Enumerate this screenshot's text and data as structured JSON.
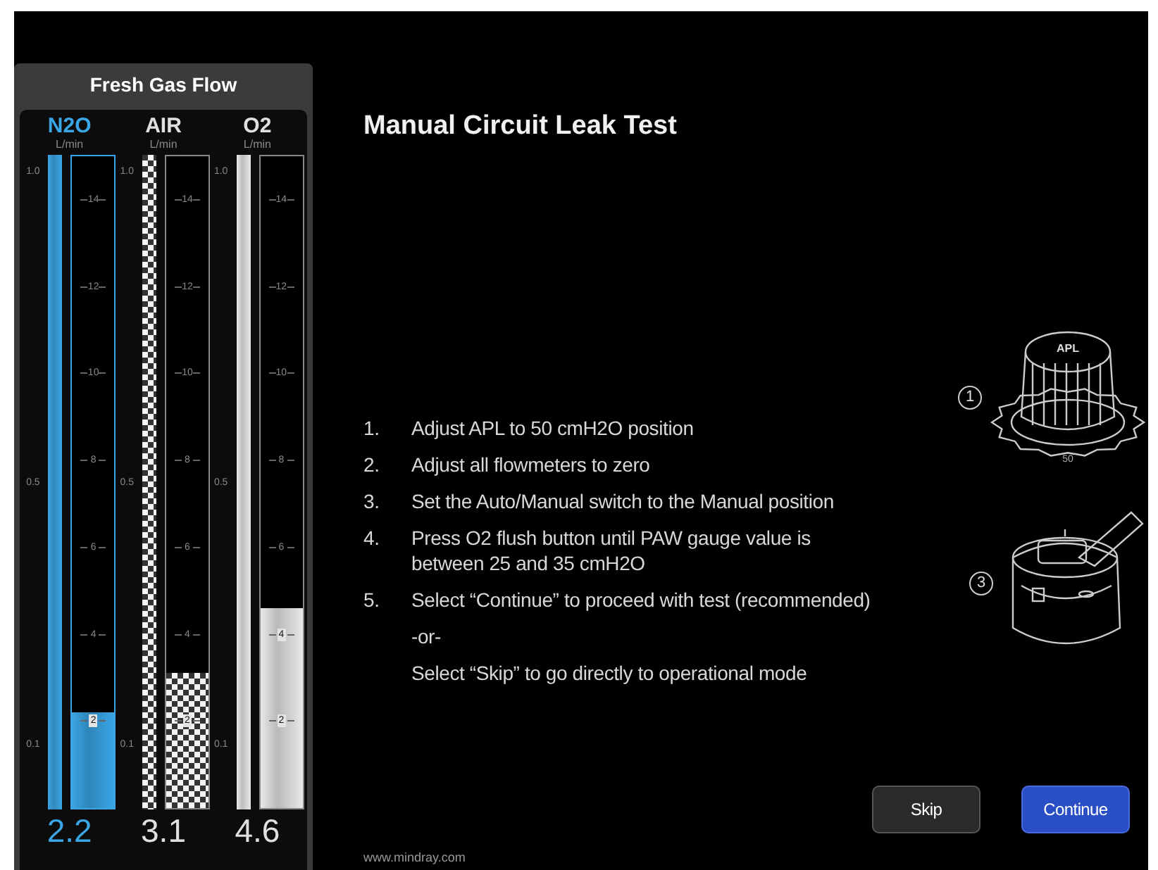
{
  "flow_panel": {
    "title": "Fresh Gas Flow",
    "gases": [
      {
        "name": "N2O",
        "unit": "L/min",
        "kind": "solid",
        "color": "#3aa6e6",
        "value": "2.2",
        "ratio_ticks": [
          "1.0",
          "0.5",
          "0.1"
        ],
        "tube_ticks": [
          "14",
          "12",
          "10",
          "8",
          "6",
          "4",
          "2"
        ],
        "ratio_bar": {
          "level": 1
        },
        "flow_tube": {
          "level": 0.147
        }
      },
      {
        "name": "AIR",
        "unit": "L/min",
        "kind": "checker",
        "color": "#e8e8e8",
        "value": "3.1",
        "ratio_ticks": [
          "1.0",
          "0.5",
          "0.1"
        ],
        "tube_ticks": [
          "14",
          "12",
          "10",
          "8",
          "6",
          "4",
          "2"
        ],
        "ratio_bar": {
          "level": 1
        },
        "flow_tube": {
          "level": 0.207
        }
      },
      {
        "name": "O2",
        "unit": "L/min",
        "kind": "solid",
        "color": "#e8e8e8",
        "value": "4.6",
        "ratio_ticks": [
          "1.0",
          "0.5",
          "0.1"
        ],
        "tube_ticks": [
          "14",
          "12",
          "10",
          "8",
          "6",
          "4",
          "2"
        ],
        "ratio_bar": {
          "level": 1
        },
        "flow_tube": {
          "level": 0.307
        }
      }
    ]
  },
  "title": "Manual Circuit Leak Test",
  "steps": [
    {
      "number": "1.",
      "text": "Adjust APL to 50 cmH2O position"
    },
    {
      "number": "2.",
      "text": "Adjust all flowmeters to zero"
    },
    {
      "number": "3.",
      "text": "Set the Auto/Manual switch to the Manual position"
    },
    {
      "number": "4.",
      "text": "Press O2 flush button until PAW gauge value is\nbetween 25 and 35 cmH2O"
    },
    {
      "number": "5.",
      "text": "Select “Continue” to proceed with test (recommended)"
    },
    {
      "text": "-or-"
    },
    {
      "text": "Select “Skip” to go directly to operational mode"
    }
  ],
  "illustrations": [
    {
      "kind": "knob",
      "callout": "1",
      "label": "APL",
      "setting": "50"
    },
    {
      "kind": "switch",
      "callout": "3"
    }
  ],
  "buttons": [
    {
      "label": "Skip",
      "kind": "secondary"
    },
    {
      "label": "Continue",
      "kind": "primary"
    }
  ],
  "footer": "www.mindray.com"
}
